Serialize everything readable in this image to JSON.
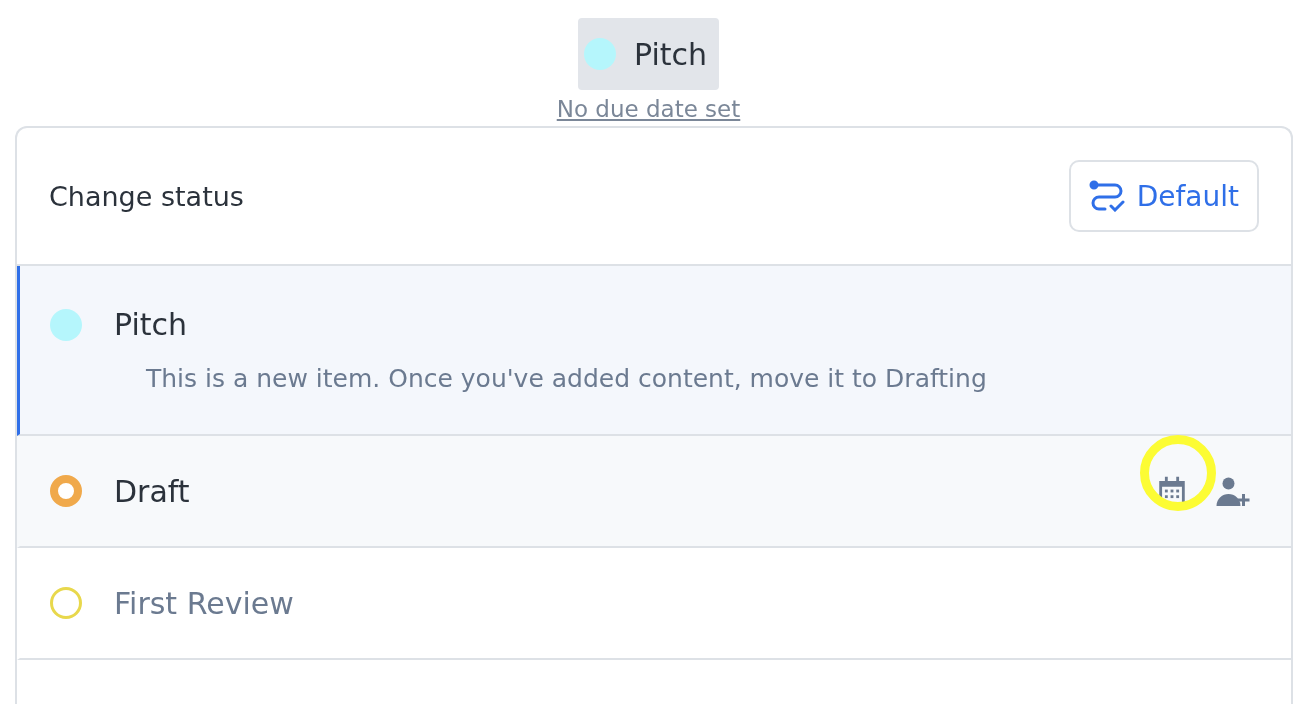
{
  "current_status": {
    "label": "Pitch",
    "color": "#b5f6fc"
  },
  "due_date_link": "No due date set",
  "status_menu": {
    "title": "Change status",
    "workflow_button": "Default",
    "statuses": [
      {
        "label": "Pitch",
        "kind": "filled",
        "color": "#b5f6fc",
        "selected": true,
        "hovered": false,
        "dimmed": false,
        "description": "This is a new item. Once you've added content, move it to Drafting"
      },
      {
        "label": "Draft",
        "kind": "ring",
        "color": "#f0a94b",
        "selected": false,
        "hovered": true,
        "dimmed": false,
        "calendar_highlighted": true
      },
      {
        "label": "First Review",
        "kind": "thin-ring",
        "color": "#e8d84c",
        "selected": false,
        "hovered": false,
        "dimmed": true
      }
    ]
  }
}
